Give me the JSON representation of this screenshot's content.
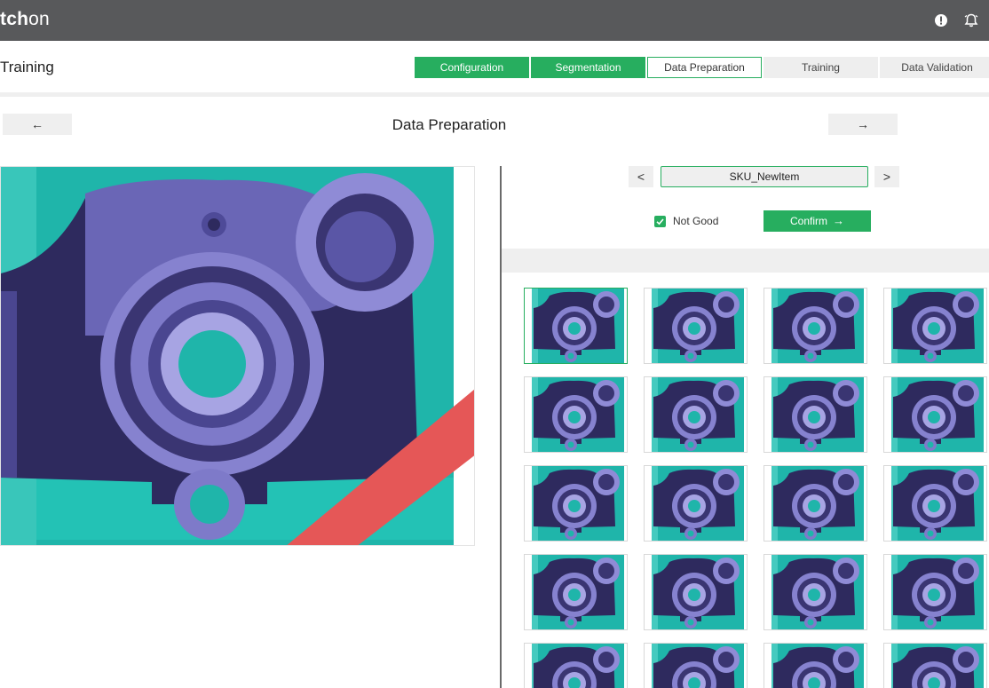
{
  "app": {
    "logo_bold": "tch",
    "logo_light": "on"
  },
  "header": {
    "title": "Training",
    "steps": [
      {
        "label": "Configuration",
        "state": "done"
      },
      {
        "label": "Segmentation",
        "state": "done"
      },
      {
        "label": "Data Preparation",
        "state": "current"
      },
      {
        "label": "Training",
        "state": "pending"
      },
      {
        "label": "Data Validation",
        "state": "pending"
      }
    ]
  },
  "section": {
    "title": "Data Preparation",
    "prev_label": "←",
    "next_label": "→"
  },
  "sku": {
    "prev_label": "<",
    "value": "SKU_NewItem",
    "next_label": ">"
  },
  "label_control": {
    "checkbox_label": "Not Good",
    "checked": true,
    "confirm_label": "Confirm",
    "confirm_arrow": "→"
  },
  "thumbnails": {
    "count": 20,
    "columns": 4,
    "selected_index": 0
  },
  "colors": {
    "accent": "#27ae5f",
    "topbar": "#58595b",
    "part": "#3a3572",
    "part_light": "#7d7ad0",
    "background_teal": "#1fb5aa",
    "overlay_red": "#e55757"
  },
  "icons": {
    "topbar": [
      "alert-icon",
      "bell-icon"
    ]
  }
}
